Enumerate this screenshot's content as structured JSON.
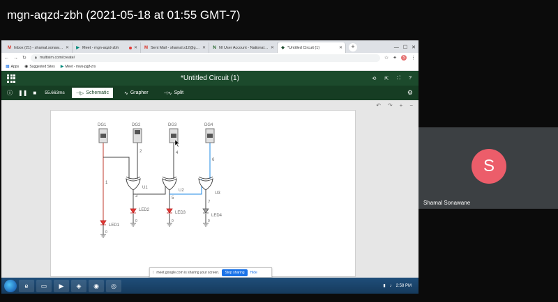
{
  "meeting": {
    "title": "mgn-aqzd-zbh (2021-05-18 at 01:55 GMT-7)",
    "participant_initial": "S",
    "participant_name": "Shamal Sonawane",
    "participant_color": "#ec5d6a"
  },
  "browser": {
    "tabs": [
      {
        "icon": "M",
        "label": "Inbox (21) - shamal.sonawane@...",
        "active": false
      },
      {
        "icon": "▶",
        "label": "Meet - mgn-aqzd-zbh",
        "active": false,
        "recording": true
      },
      {
        "icon": "M",
        "label": "Sent Mail - shamal.s12@gmail.c...",
        "active": false
      },
      {
        "icon": "N",
        "label": "NI User Account - National Instr...",
        "active": false
      },
      {
        "icon": "◆",
        "label": "*Untitled Circuit (1)",
        "active": true
      }
    ],
    "url": "multisim.com/create/",
    "bookmarks": [
      {
        "icon": "▦",
        "label": "Apps"
      },
      {
        "icon": "◉",
        "label": "Suggested Sites"
      },
      {
        "icon": "▶",
        "label": "Meet - mws-pgjf-zrs"
      }
    ]
  },
  "multisim": {
    "title": "*Untitled Circuit (1)",
    "sim_time": "55.663ms",
    "views": [
      {
        "icon": "⊣▷",
        "label": "Schematic",
        "active": true
      },
      {
        "icon": "∿",
        "label": "Grapher",
        "active": false
      },
      {
        "icon": "⊣∿",
        "label": "Split",
        "active": false
      }
    ],
    "brand_color": "#1c4a2c"
  },
  "circuit": {
    "switches": [
      "DG1",
      "DG2",
      "DG3",
      "DG4"
    ],
    "nets": [
      "1",
      "2",
      "3",
      "4",
      "5",
      "6",
      "7"
    ],
    "gates": [
      "U1",
      "U2",
      "U3"
    ],
    "leds": [
      "LED1",
      "LED2",
      "LED3",
      "LED4"
    ],
    "grounds": [
      "0",
      "0",
      "0",
      "0"
    ]
  },
  "sharebar": {
    "text": "meet.google.com is sharing your screen.",
    "stop_label": "Stop sharing",
    "hide_label": "Hide"
  },
  "taskbar": {
    "clock": "2:58 PM"
  }
}
